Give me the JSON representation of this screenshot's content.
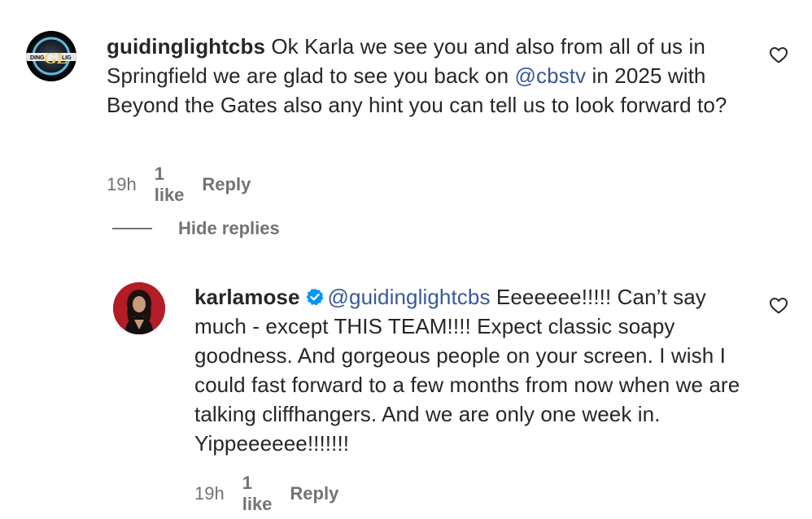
{
  "comment": {
    "username": "guidinglightcbs",
    "text_before_mention": " Ok Karla we see you and also from all of us in Springfield we are glad to see you back on ",
    "mention": "@cbstv",
    "text_after_mention": " in 2025 with Beyond the Gates also any hint you can tell us to look forward to?",
    "time": "19h",
    "likes": "1 like",
    "reply_label": "Reply",
    "avatar_text": "GL",
    "avatar_small_text": "DING",
    "avatar_small_text_right": "LIG"
  },
  "hide_replies_label": "Hide replies",
  "reply": {
    "username": "karlamose",
    "mention": "@guidinglightcbs",
    "text_after_mention": " Eeeeeee!!!!! Can’t say much - except THIS TEAM!!!! Expect classic soapy goodness. And gorgeous people on your screen. I wish I could fast forward to a few months from now when we are talking cliffhangers. And we are only one week in. Yippeeeeee!!!!!!!",
    "time": "19h",
    "likes": "1 like",
    "reply_label": "Reply"
  },
  "colors": {
    "text": "#262626",
    "meta": "#737373",
    "mention": "#385898",
    "verified": "#0095f6"
  },
  "icons": [
    "heart-icon",
    "verified-badge-icon"
  ]
}
